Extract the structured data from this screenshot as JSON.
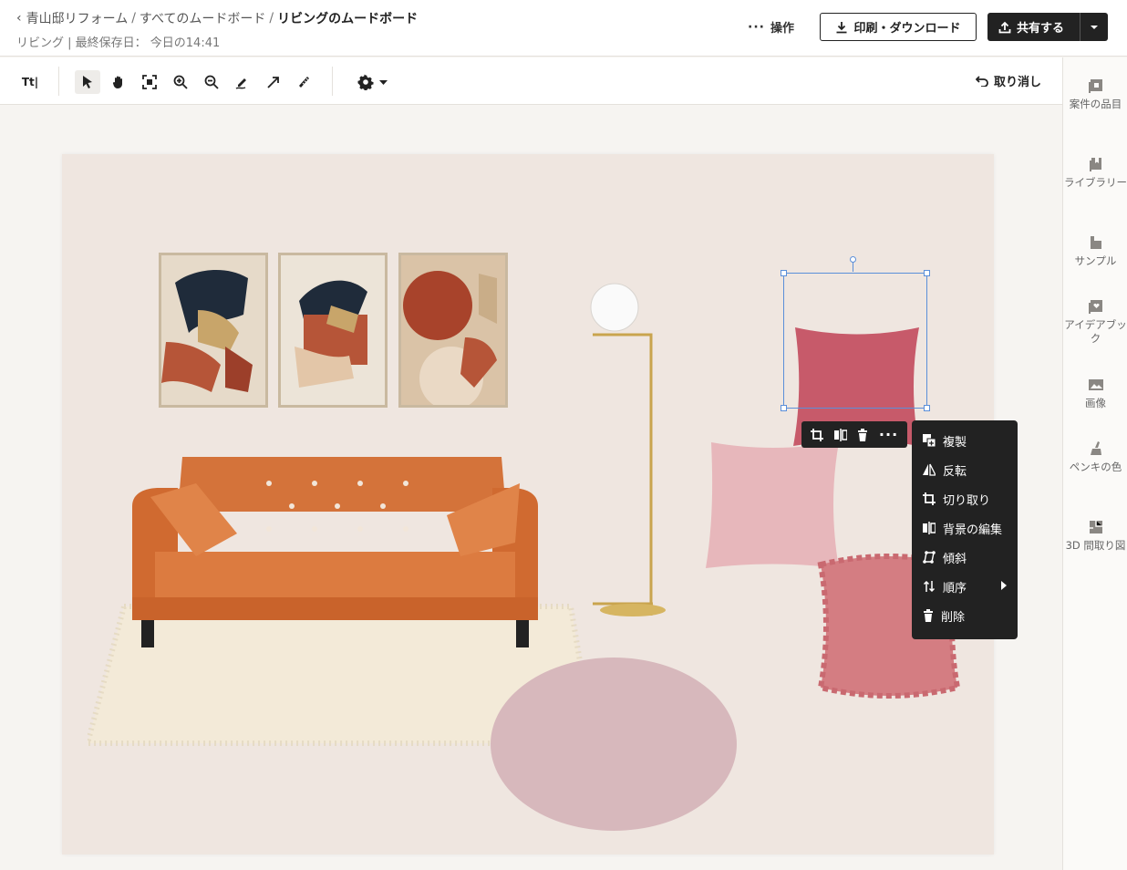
{
  "header": {
    "breadcrumb": {
      "back_icon": "chevron-left-icon",
      "project": "青山邸リフォーム",
      "all_boards": "すべてのムードボード",
      "current": "リビングのムードボード"
    },
    "subline": "リビング | 最終保存日： 今日の14:41",
    "ops_label": "操作",
    "print_label": "印刷・ダウンロード",
    "share_label": "共有する"
  },
  "toolbar": {
    "text_tool_label": "Tt|",
    "undo_label": "取り消し"
  },
  "right_panel": {
    "items": [
      {
        "label": "案件の品目",
        "icon": "project-items-icon"
      },
      {
        "label": "ライブラリー",
        "icon": "library-icon"
      },
      {
        "label": "サンプル",
        "icon": "sample-icon"
      },
      {
        "label": "アイデアブック",
        "icon": "ideabook-icon"
      },
      {
        "label": "画像",
        "icon": "image-icon"
      },
      {
        "label": "ペンキの色",
        "icon": "paint-brush-icon"
      },
      {
        "label": "3D 間取り図",
        "icon": "floorplan-icon"
      }
    ]
  },
  "context_menu": {
    "items": [
      {
        "label": "複製",
        "icon": "duplicate-icon"
      },
      {
        "label": "反転",
        "icon": "flip-icon"
      },
      {
        "label": "切り取り",
        "icon": "crop-icon"
      },
      {
        "label": "背景の編集",
        "icon": "background-edit-icon"
      },
      {
        "label": "傾斜",
        "icon": "skew-icon"
      },
      {
        "label": "順序",
        "icon": "order-icon"
      },
      {
        "label": "削除",
        "icon": "trash-icon"
      }
    ]
  },
  "colors": {
    "accent_dark": "#222222",
    "selection": "#5b8fd9",
    "board_bg": "#efe6e0"
  }
}
